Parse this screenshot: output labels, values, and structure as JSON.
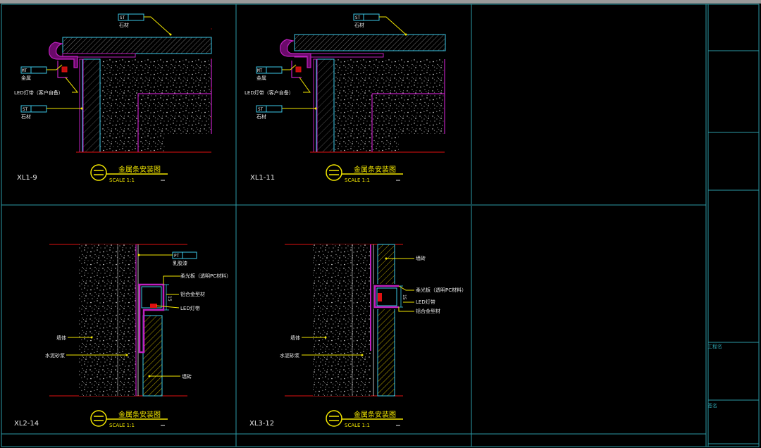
{
  "title_block": {
    "field_project": "工程名",
    "field_sign": "签名"
  },
  "details": [
    {
      "id": "XL1-9",
      "title": "金属条安装图",
      "scale": "SCALE 1:1",
      "tags": [
        {
          "code": "ST",
          "text": "石材"
        },
        {
          "code": "MT",
          "text": "金属"
        },
        {
          "code": "ST",
          "text": "石材"
        }
      ],
      "notes": [
        "LED灯带（客户自备）"
      ]
    },
    {
      "id": "XL1-11",
      "title": "金属条安装图",
      "scale": "SCALE 1:1",
      "tags": [
        {
          "code": "ST",
          "text": "石材"
        },
        {
          "code": "MT",
          "text": "金属"
        },
        {
          "code": "ST",
          "text": "石材"
        }
      ],
      "notes": [
        "LED灯带（客户自备）"
      ]
    },
    {
      "id": "XL2-14",
      "title": "金属条安装图",
      "scale": "SCALE 1:1",
      "tags": [
        {
          "code": "PT",
          "text": "乳胶漆"
        }
      ],
      "notes": [
        "柔光板（透明PC材料）",
        "铝合金型材",
        "LED灯带",
        "墙体",
        "水泥砂浆",
        "墙砖"
      ],
      "dim": "15"
    },
    {
      "id": "XL3-12",
      "title": "金属条安装图",
      "scale": "SCALE 1:1",
      "tags": [],
      "notes": [
        "墙砖",
        "柔光板（透明PC材料）",
        "LED灯带",
        "铝合金型材",
        "墙体",
        "水泥砂浆"
      ],
      "dim": "15"
    }
  ],
  "colors": {
    "background": "#000000",
    "frame": "#2b9aa6",
    "yellow": "#f2e600",
    "magenta": "#c020c0",
    "red": "#e01010",
    "cyan": "#3cc8e8",
    "white": "#e8e8e8"
  }
}
